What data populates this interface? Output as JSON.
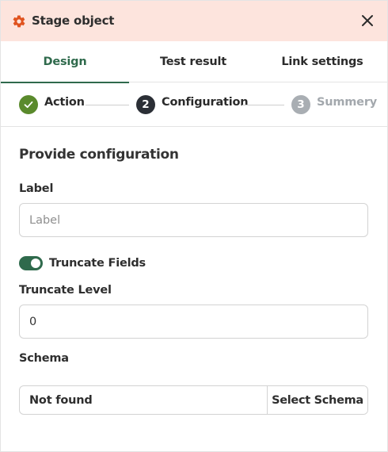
{
  "header": {
    "title": "Stage object",
    "accent_color": "#e0531f",
    "background_color": "#fde4dd"
  },
  "tabs": [
    {
      "label": "Design",
      "active": true
    },
    {
      "label": "Test result",
      "active": false
    },
    {
      "label": "Link settings",
      "active": false
    }
  ],
  "stepper": {
    "steps": [
      {
        "label": "Action",
        "state": "completed",
        "marker": "check"
      },
      {
        "label": "Configuration",
        "state": "current",
        "marker": "2"
      },
      {
        "label": "Summery",
        "state": "upcoming",
        "marker": "3"
      }
    ]
  },
  "form": {
    "section_title": "Provide configuration",
    "label_field": {
      "label": "Label",
      "placeholder": "Label",
      "value": ""
    },
    "truncate_toggle": {
      "label": "Truncate Fields",
      "enabled": true
    },
    "truncate_level": {
      "label": "Truncate Level",
      "value": "0"
    },
    "schema": {
      "label": "Schema",
      "value": "Not found",
      "button_label": "Select Schema"
    }
  },
  "colors": {
    "primary_green": "#2f6a4c",
    "completed_green": "#5a8a2c",
    "current_dark": "#2b2f36",
    "upcoming_grey": "#a9aeb3"
  },
  "icons": {
    "header": "gear-icon",
    "close": "close-icon",
    "step_completed": "check-icon"
  }
}
